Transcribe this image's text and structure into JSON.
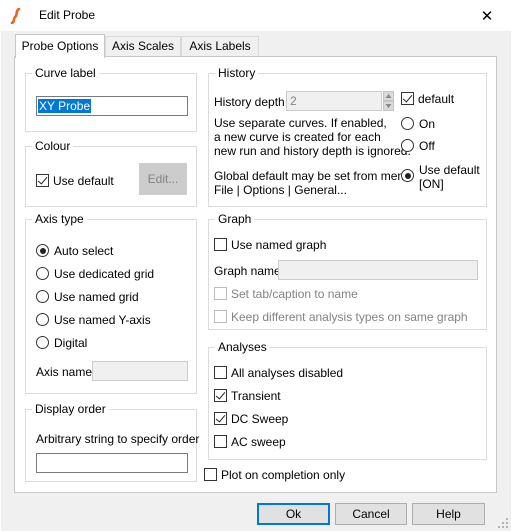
{
  "window": {
    "title": "Edit Probe",
    "close_glyph": "✕"
  },
  "tabs": [
    {
      "label": "Probe Options"
    },
    {
      "label": "Axis Scales"
    },
    {
      "label": "Axis Labels"
    }
  ],
  "curve_label": {
    "legend": "Curve label",
    "value": "XY Probe"
  },
  "colour": {
    "legend": "Colour",
    "use_default_label": "Use default",
    "use_default_checked": true,
    "edit_button": "Edit..."
  },
  "axis_type": {
    "legend": "Axis type",
    "options": [
      {
        "label": "Auto select",
        "checked": true
      },
      {
        "label": "Use dedicated grid",
        "checked": false
      },
      {
        "label": "Use named grid",
        "checked": false
      },
      {
        "label": "Use named Y-axis",
        "checked": false
      },
      {
        "label": "Digital",
        "checked": false
      }
    ],
    "axis_name_label": "Axis name",
    "axis_name_value": ""
  },
  "display_order": {
    "legend": "Display order",
    "description": "Arbitrary string to specify order",
    "value": ""
  },
  "history": {
    "legend": "History",
    "depth_label": "History depth",
    "depth_value": "2",
    "default_label": "default",
    "default_checked": true,
    "separate_curves_text": [
      "Use separate curves. If enabled,",
      "a new curve is created for each",
      "new run and history depth is ignored."
    ],
    "on_label": "On",
    "off_label": "Off",
    "global_text": [
      "Global default may be set from menu",
      "File | Options | General..."
    ],
    "use_default_label": [
      "Use default",
      "[ON]"
    ],
    "selected": "use_default"
  },
  "graph": {
    "legend": "Graph",
    "use_named_graph_label": "Use named graph",
    "use_named_graph_checked": false,
    "graph_name_label": "Graph name",
    "graph_name_value": "",
    "set_tab_label": "Set tab/caption to name",
    "keep_different_label": "Keep different analysis types on same graph"
  },
  "analyses": {
    "legend": "Analyses",
    "items": [
      {
        "label": "All analyses disabled",
        "checked": false
      },
      {
        "label": "Transient",
        "checked": true
      },
      {
        "label": "DC Sweep",
        "checked": true
      },
      {
        "label": "AC sweep",
        "checked": false
      }
    ]
  },
  "plot_on_completion": {
    "label": "Plot on completion only",
    "checked": false
  },
  "buttons": {
    "ok": "Ok",
    "cancel": "Cancel",
    "help": "Help"
  },
  "colors": {
    "accent": "#0078d7",
    "logo": "#e8651a"
  }
}
